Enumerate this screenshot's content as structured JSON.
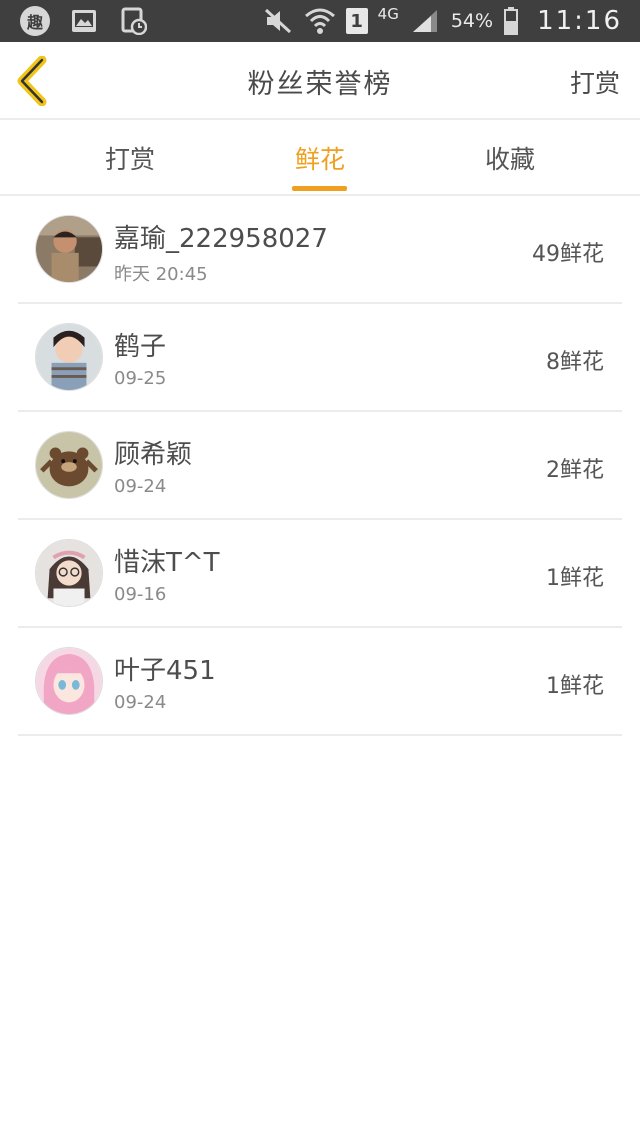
{
  "status_bar": {
    "app_badge": "趣",
    "sim_slot": "1",
    "network": "4G",
    "battery": "54%",
    "time": "11:16",
    "colors": {
      "background": "#3f3f3f",
      "text": "#f0f0f0"
    }
  },
  "header": {
    "title": "粉丝荣誉榜",
    "right_action": "打赏",
    "back_icon": "chevron-left-icon",
    "accent_color": "#f0c419"
  },
  "tabs": [
    {
      "label": "打赏",
      "active": false
    },
    {
      "label": "鲜花",
      "active": true
    },
    {
      "label": "收藏",
      "active": false
    }
  ],
  "accent_color": "#f0a020",
  "fans": [
    {
      "name": "嘉瑜_222958027",
      "time": "昨天 20:45",
      "count": "49鲜花",
      "avatar": "boy-photo"
    },
    {
      "name": "鹤子",
      "time": "09-25",
      "count": "8鲜花",
      "avatar": "girl-photo"
    },
    {
      "name": "顾希颖",
      "time": "09-24",
      "count": "2鲜花",
      "avatar": "bear-cartoon"
    },
    {
      "name": "惜沫T^T",
      "time": "09-16",
      "count": "1鲜花",
      "avatar": "girl-glasses-photo"
    },
    {
      "name": "叶子451",
      "time": "09-24",
      "count": "1鲜花",
      "avatar": "anime-girl"
    }
  ]
}
